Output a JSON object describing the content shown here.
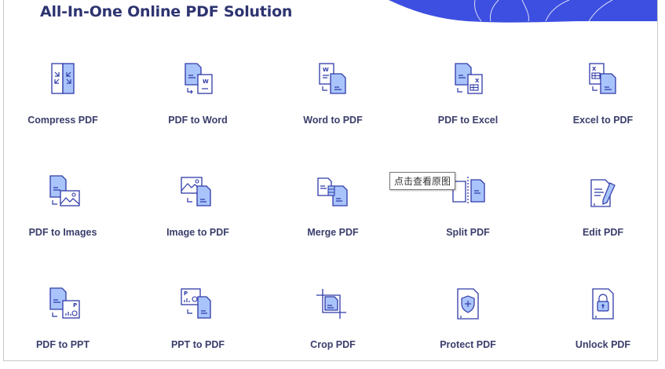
{
  "header": {
    "title": "All-In-One Online PDF Solution"
  },
  "colors": {
    "title": "#2e3470",
    "label": "#3a3e6b",
    "icon_stroke": "#2f3aa8",
    "icon_fill": "#a9c4fb",
    "deco": "#3d4fe0"
  },
  "tools": [
    {
      "label": "Compress PDF",
      "icon": "compress-pdf-icon"
    },
    {
      "label": "PDF to Word",
      "icon": "pdf-to-word-icon"
    },
    {
      "label": "Word to PDF",
      "icon": "word-to-pdf-icon"
    },
    {
      "label": "PDF to Excel",
      "icon": "pdf-to-excel-icon"
    },
    {
      "label": "Excel to PDF",
      "icon": "excel-to-pdf-icon"
    },
    {
      "label": "PDF to Images",
      "icon": "pdf-to-images-icon"
    },
    {
      "label": "Image to PDF",
      "icon": "image-to-pdf-icon"
    },
    {
      "label": "Merge PDF",
      "icon": "merge-pdf-icon"
    },
    {
      "label": "Split PDF",
      "icon": "split-pdf-icon"
    },
    {
      "label": "Edit PDF",
      "icon": "edit-pdf-icon"
    },
    {
      "label": "PDF to PPT",
      "icon": "pdf-to-ppt-icon"
    },
    {
      "label": "PPT to PDF",
      "icon": "ppt-to-pdf-icon"
    },
    {
      "label": "Crop PDF",
      "icon": "crop-pdf-icon"
    },
    {
      "label": "Protect PDF",
      "icon": "protect-pdf-icon"
    },
    {
      "label": "Unlock PDF",
      "icon": "unlock-pdf-icon"
    }
  ],
  "tooltip": {
    "text": "点击查看原图"
  }
}
